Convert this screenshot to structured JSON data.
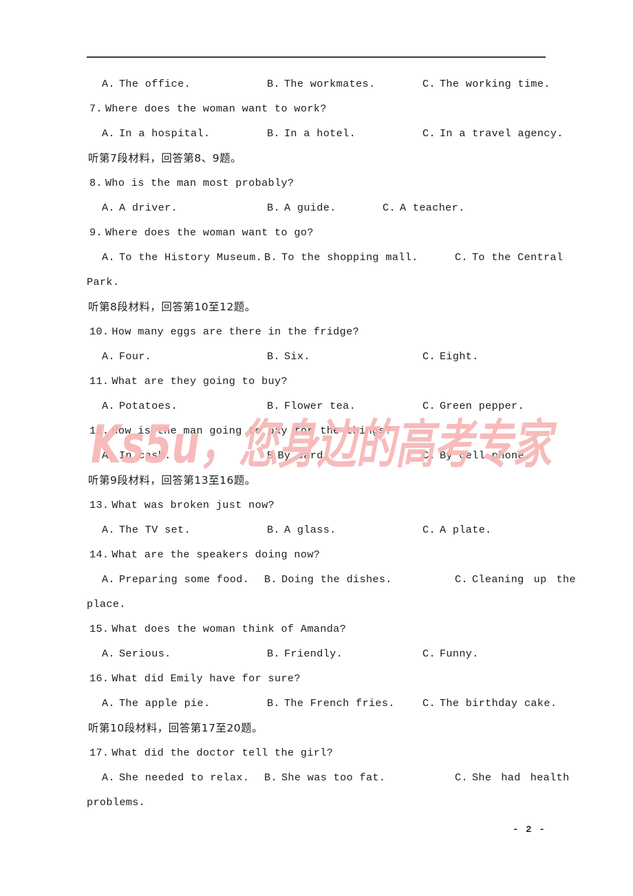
{
  "page": {
    "number_label": "- 2 -",
    "background": "#ffffff",
    "text_color": "#1c1c1c",
    "rule_color": "#3a3a3a"
  },
  "watermark": {
    "text": "Ks5u，您身边的高考专家",
    "latin_part": "Ks5u，",
    "cjk_part": "您身边的高考专家",
    "color": "#f7b6b6"
  },
  "blocks": [
    {
      "type": "options",
      "a": {
        "letter": "A.",
        "text": "The office."
      },
      "b": {
        "letter": "B.",
        "text": "The workmates."
      },
      "c": {
        "letter": "C.",
        "text": "The working time."
      }
    },
    {
      "type": "question",
      "number": "7.",
      "text": "Where does the woman want to work?"
    },
    {
      "type": "options",
      "a": {
        "letter": "A.",
        "text": "In a hospital."
      },
      "b": {
        "letter": "B.",
        "text": "In a hotel."
      },
      "c": {
        "letter": "C.",
        "text": "In a travel agency."
      }
    },
    {
      "type": "chinese",
      "text": "听第7段材料，回答第8、9题。"
    },
    {
      "type": "question",
      "number": "8.",
      "text": "Who is the man most probably?"
    },
    {
      "type": "options",
      "narrow": true,
      "a": {
        "letter": "A.",
        "text": "A driver."
      },
      "b": {
        "letter": "B.",
        "text": "A guide."
      },
      "c": {
        "letter": "C.",
        "text": "A teacher."
      }
    },
    {
      "type": "question",
      "number": "9.",
      "text": "Where does the woman want to go?"
    },
    {
      "type": "options",
      "wide": true,
      "a": {
        "letter": "A.",
        "text": "To the History Museum."
      },
      "b": {
        "letter": "B.",
        "text": "To the shopping mall."
      },
      "c": {
        "letter": "C.",
        "text": "To the Central"
      }
    },
    {
      "type": "continuation",
      "text": "Park."
    },
    {
      "type": "chinese",
      "text": "听第8段材料，回答第10至12题。"
    },
    {
      "type": "question",
      "number": "10.",
      "text": "How many eggs are there in the fridge?"
    },
    {
      "type": "options",
      "a": {
        "letter": "A.",
        "text": "Four."
      },
      "b": {
        "letter": "B.",
        "text": "Six."
      },
      "c": {
        "letter": "C.",
        "text": "Eight."
      }
    },
    {
      "type": "question",
      "number": "11.",
      "text": "What are they going to buy?"
    },
    {
      "type": "options",
      "a": {
        "letter": "A.",
        "text": "Potatoes."
      },
      "b": {
        "letter": "B.",
        "text": "Flower tea."
      },
      "c": {
        "letter": "C.",
        "text": "Green pepper."
      }
    },
    {
      "type": "question",
      "number": "12.",
      "text": "How is the man going to pay for the things?"
    },
    {
      "type": "options",
      "a": {
        "letter": "A.",
        "text": "In cash."
      },
      "b": {
        "letter": "B",
        "text": "By card."
      },
      "c": {
        "letter": "C.",
        "text": "By cell phone."
      }
    },
    {
      "type": "chinese",
      "text": "听第9段材料，回答第13至16题。"
    },
    {
      "type": "question",
      "number": "13.",
      "text": "What was broken just now?"
    },
    {
      "type": "options",
      "a": {
        "letter": "A.",
        "text": "The TV set."
      },
      "b": {
        "letter": "B.",
        "text": "A glass."
      },
      "c": {
        "letter": "C.",
        "text": "A plate."
      }
    },
    {
      "type": "question",
      "number": "14.",
      "text": "What are the speakers doing now?"
    },
    {
      "type": "options",
      "wide": true,
      "spread_c": true,
      "a": {
        "letter": "A.",
        "text": "Preparing some food."
      },
      "b": {
        "letter": "B.",
        "text": "Doing the dishes."
      },
      "c": {
        "letter": "C.",
        "text": "Cleaning up the"
      }
    },
    {
      "type": "continuation",
      "text": "place."
    },
    {
      "type": "question",
      "number": "15.",
      "text": "What does the woman think of Amanda?"
    },
    {
      "type": "options",
      "a": {
        "letter": "A.",
        "text": "Serious."
      },
      "b": {
        "letter": "B.",
        "text": "Friendly."
      },
      "c": {
        "letter": "C.",
        "text": "Funny."
      }
    },
    {
      "type": "question",
      "number": "16.",
      "text": "What did Emily have for sure?"
    },
    {
      "type": "options",
      "a": {
        "letter": "A.",
        "text": "The apple pie."
      },
      "b": {
        "letter": "B.",
        "text": "The French fries."
      },
      "c": {
        "letter": "C.",
        "text": "The birthday cake."
      }
    },
    {
      "type": "chinese",
      "text": "听第10段材料，回答第17至20题。"
    },
    {
      "type": "question",
      "number": "17.",
      "text": "What did the doctor tell the girl?"
    },
    {
      "type": "options",
      "wide": true,
      "spread_c": true,
      "a": {
        "letter": "A.",
        "text": "She needed to relax."
      },
      "b": {
        "letter": "B.",
        "text": "She was too fat."
      },
      "c": {
        "letter": "C.",
        "text": "She had health"
      }
    },
    {
      "type": "continuation",
      "text": "problems."
    }
  ]
}
